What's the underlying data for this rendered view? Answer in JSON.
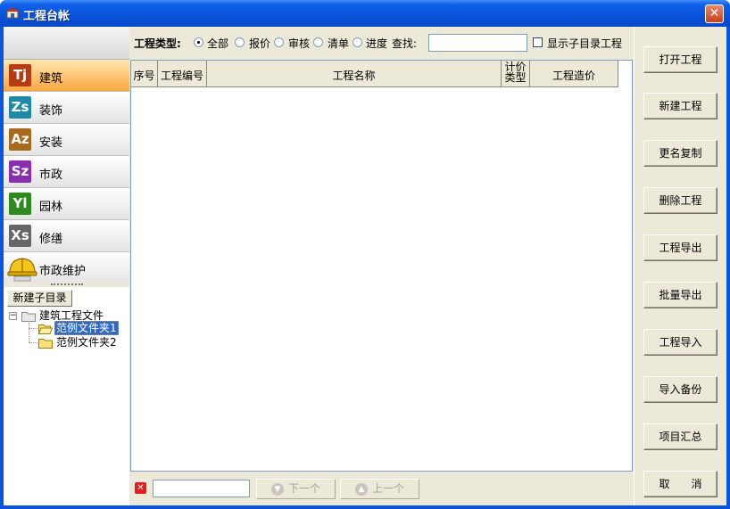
{
  "window": {
    "title": "工程台帐",
    "close_glyph": "✕"
  },
  "categories": [
    {
      "abbr": "Tj",
      "label": "建筑",
      "color": "#b63a12",
      "active": true
    },
    {
      "abbr": "Zs",
      "label": "装饰",
      "color": "#1e8aa8",
      "active": false
    },
    {
      "abbr": "Az",
      "label": "安装",
      "color": "#a86a1e",
      "active": false
    },
    {
      "abbr": "Sz",
      "label": "市政",
      "color": "#8a2eb0",
      "active": false
    },
    {
      "abbr": "Yl",
      "label": "园林",
      "color": "#2e8a1e",
      "active": false
    },
    {
      "abbr": "Xs",
      "label": "修缮",
      "color": "#666666",
      "active": false
    },
    {
      "abbr": "",
      "label": "市政维护",
      "color": "#f0c020",
      "active": false,
      "icon": "hardhat-icon"
    }
  ],
  "tree": {
    "new_sub_label": "新建子目录",
    "root": "建筑工程文件",
    "children": [
      "范例文件夹1",
      "范例文件夹2"
    ],
    "selected_index": 0
  },
  "filter": {
    "type_label": "工程类型:",
    "options": [
      "全部",
      "报价",
      "审核",
      "清单",
      "进度"
    ],
    "selected": "全部",
    "search_label": "查找:",
    "search_value": "",
    "show_sub_label": "显示子目录工程",
    "show_sub_checked": false
  },
  "grid": {
    "columns": [
      "序号",
      "工程编号",
      "工程名称",
      "计价\n类型",
      "工程造价"
    ],
    "col_line1": "计价",
    "col_line2": "类型",
    "rows": []
  },
  "bottom": {
    "next_label": "下一个",
    "prev_label": "上一个",
    "input_value": ""
  },
  "actions": [
    "打开工程",
    "新建工程",
    "更名复制",
    "删除工程",
    "工程导出",
    "批量导出",
    "工程导入",
    "导入备份",
    "项目汇总",
    "取　　消"
  ]
}
